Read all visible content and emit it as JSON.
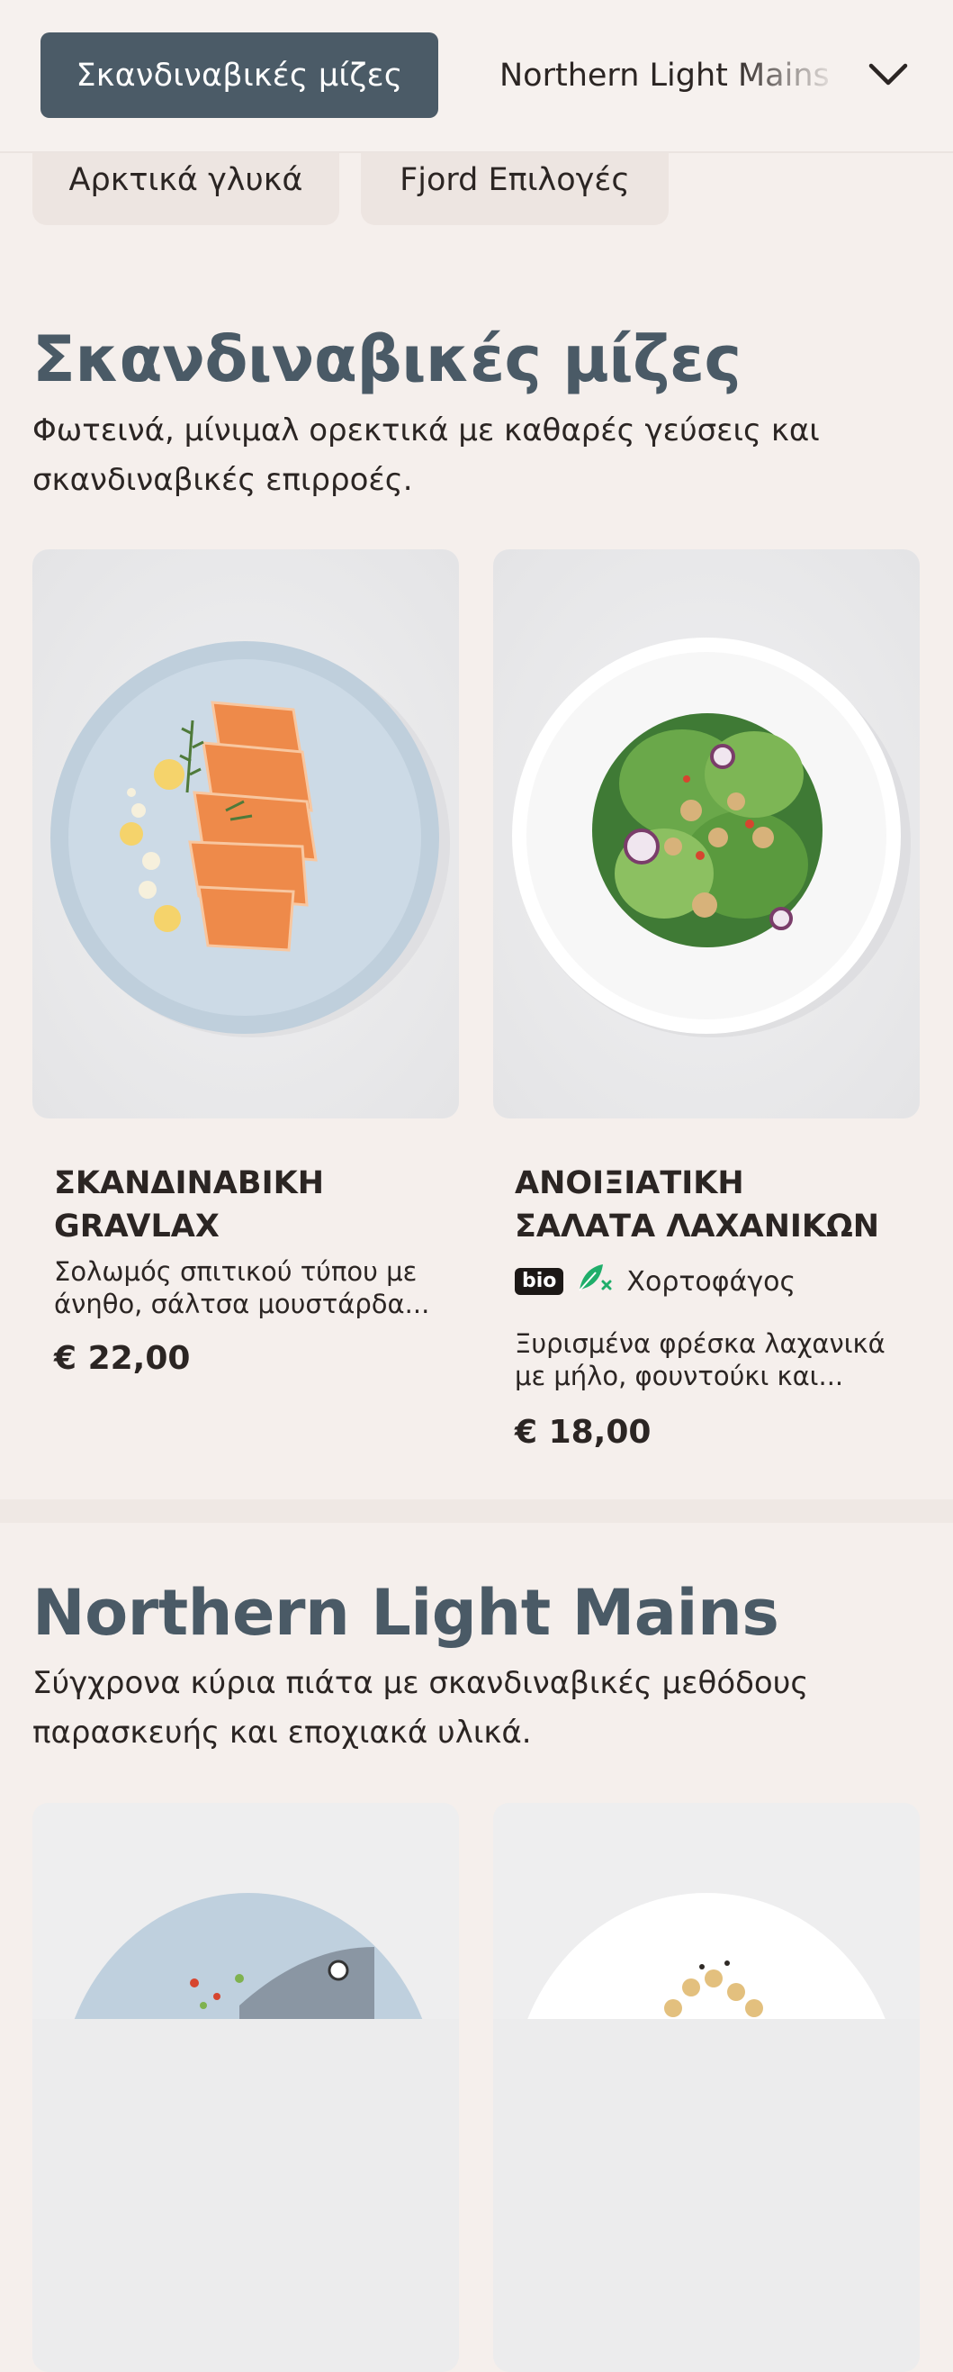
{
  "nav": {
    "active_category": "Σκανδιναβικές μίζες",
    "next_category": "Northern Light Mains",
    "pills": [
      "Αρκτικά γλυκά",
      "Fjord Επιλογές"
    ]
  },
  "sections": [
    {
      "title": "Σκανδιναβικές μίζες",
      "description": "Φωτεινά, μίνιμαλ ορεκτικά με καθαρές γεύσεις και σκανδιναβικές επιρροές.",
      "items": [
        {
          "name": "ΣΚΑΝΔΙΝΑΒΙΚΗ GRAVLAX",
          "description": "Σολωμός σπιτικού τύπου με άνηθο, σάλτσα μουστάρδα...",
          "price": "€ 22,00"
        },
        {
          "name": "ΑΝΟΙΞΙΑΤΙΚΗ ΣΑΛΑΤΑ ΛΑΧΑΝΙΚΩΝ",
          "badge_bio": "bio",
          "badge_diet": "Χορτοφάγος",
          "description": "Ξυρισμένα φρέσκα λαχανικά με μήλο, φουντούκι και...",
          "price": "€ 18,00"
        }
      ]
    },
    {
      "title": "Northern Light Mains",
      "description": "Σύγχρονα κύρια πιάτα με σκανδιναβικές μεθόδους παρασκευής και εποχιακά υλικά."
    }
  ],
  "icons": {
    "dropdown": "chevron-down-icon",
    "vegetarian": "vegetarian-leaf-icon"
  },
  "colors": {
    "accent": "#4b5b67",
    "title": "#4a5a66",
    "background": "#f5efec",
    "vegetarian": "#1fae6a"
  }
}
